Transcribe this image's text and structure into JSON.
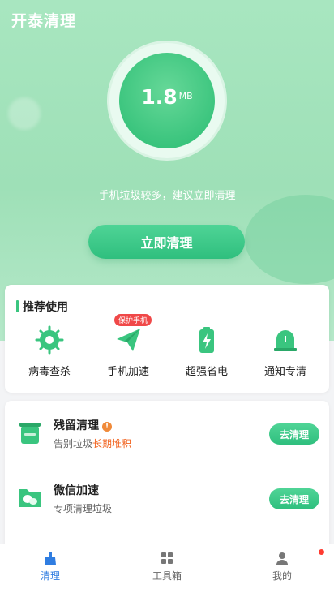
{
  "app": {
    "title": "开泰清理"
  },
  "hero": {
    "size_value": "1.8",
    "size_unit": "MB",
    "tip": "手机垃圾较多，建议立即清理",
    "clean_button": "立即清理"
  },
  "recommend": {
    "title": "推荐使用",
    "badge": "保护手机",
    "items": [
      {
        "label": "病毒查杀",
        "icon": "virus-scan-icon"
      },
      {
        "label": "手机加速",
        "icon": "paper-plane-icon"
      },
      {
        "label": "超强省电",
        "icon": "battery-icon"
      },
      {
        "label": "通知专清",
        "icon": "alarm-bell-icon"
      }
    ]
  },
  "list": [
    {
      "title": "残留清理",
      "sub_prefix": "告别垃圾",
      "sub_highlight": "长期堆积",
      "button": "去清理",
      "icon": "trash-bin-icon"
    },
    {
      "title": "微信加速",
      "sub_prefix": "专项清理垃圾",
      "sub_highlight": "",
      "button": "去清理",
      "icon": "wechat-folder-icon"
    }
  ],
  "tabs": [
    {
      "label": "清理",
      "icon": "broom-icon",
      "active": true
    },
    {
      "label": "工具箱",
      "icon": "grid-icon",
      "active": false
    },
    {
      "label": "我的",
      "icon": "user-icon",
      "active": false
    }
  ],
  "colors": {
    "accent": "#35c27a",
    "tab_active": "#2f7de1",
    "tab_inactive": "#666666",
    "highlight": "#f26522"
  }
}
